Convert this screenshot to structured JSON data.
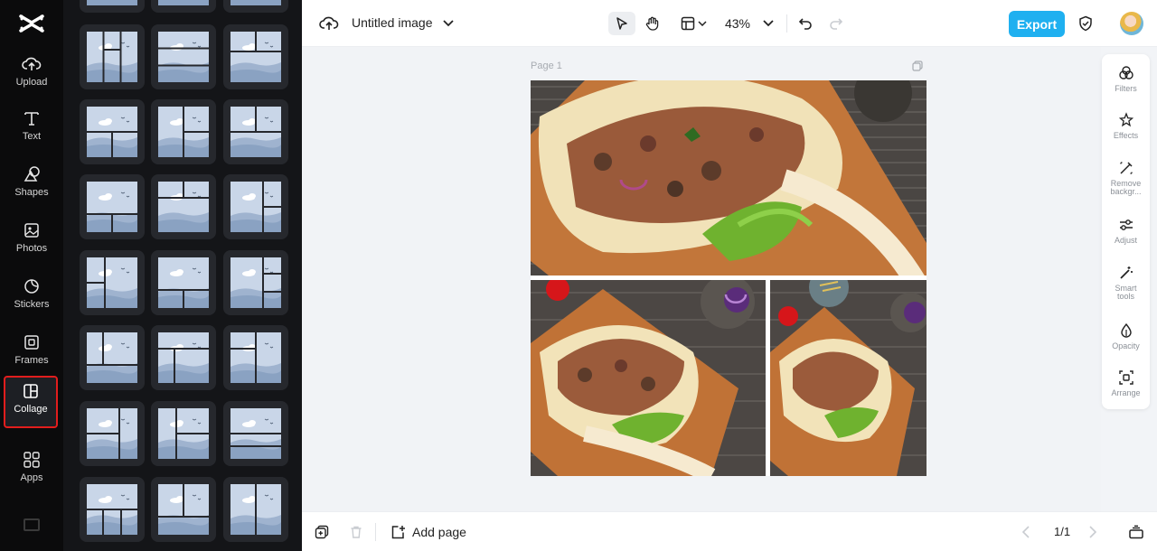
{
  "rail": {
    "items": [
      {
        "name": "upload",
        "label": "Upload",
        "icon": "cloud-upload-icon"
      },
      {
        "name": "text",
        "label": "Text",
        "icon": "text-icon"
      },
      {
        "name": "shapes",
        "label": "Shapes",
        "icon": "shapes-icon"
      },
      {
        "name": "photos",
        "label": "Photos",
        "icon": "photo-icon"
      },
      {
        "name": "stickers",
        "label": "Stickers",
        "icon": "sticker-icon"
      },
      {
        "name": "frames",
        "label": "Frames",
        "icon": "frame-icon"
      },
      {
        "name": "collage",
        "label": "Collage",
        "icon": "collage-icon",
        "active": true
      },
      {
        "name": "apps",
        "label": "Apps",
        "icon": "apps-grid-icon"
      }
    ]
  },
  "topbar": {
    "title": "Untitled image",
    "zoom": "43%",
    "export_label": "Export"
  },
  "canvas": {
    "page_label": "Page 1"
  },
  "tools": {
    "items": [
      {
        "name": "filters",
        "label": "Filters",
        "icon": "filters-icon"
      },
      {
        "name": "effects",
        "label": "Effects",
        "icon": "effects-icon"
      },
      {
        "name": "remove-background",
        "label": "Remove backgr...",
        "icon": "remove-background-icon"
      },
      {
        "name": "adjust",
        "label": "Adjust",
        "icon": "adjust-sliders-icon"
      },
      {
        "name": "smart-tools",
        "label": "Smart tools",
        "icon": "magic-wand-icon"
      },
      {
        "name": "opacity",
        "label": "Opacity",
        "icon": "opacity-drop-icon"
      },
      {
        "name": "arrange",
        "label": "Arrange",
        "icon": "arrange-icon"
      }
    ]
  },
  "bottombar": {
    "add_page_label": "Add page",
    "page_count": "1/1"
  },
  "colors": {
    "accent": "#1fb0f0",
    "rail_bg": "#0b0b0c",
    "panel_bg": "#141518",
    "active_outline": "#e11d1d"
  }
}
